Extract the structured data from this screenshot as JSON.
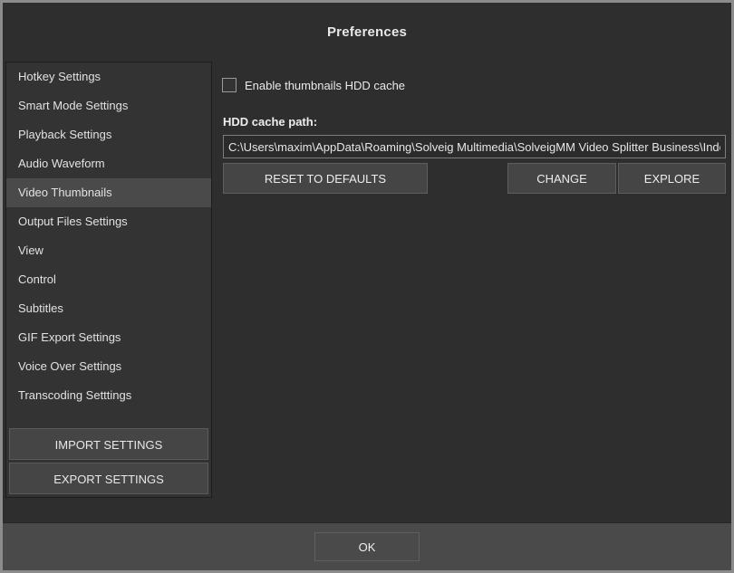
{
  "window": {
    "title": "Preferences"
  },
  "sidebar": {
    "items": [
      {
        "label": "Hotkey Settings",
        "selected": false
      },
      {
        "label": "Smart Mode Settings",
        "selected": false
      },
      {
        "label": "Playback Settings",
        "selected": false
      },
      {
        "label": "Audio Waveform",
        "selected": false
      },
      {
        "label": "Video Thumbnails",
        "selected": true
      },
      {
        "label": "Output Files Settings",
        "selected": false
      },
      {
        "label": "View",
        "selected": false
      },
      {
        "label": "Control",
        "selected": false
      },
      {
        "label": "Subtitles",
        "selected": false
      },
      {
        "label": "GIF Export Settings",
        "selected": false
      },
      {
        "label": "Voice Over Settings",
        "selected": false
      },
      {
        "label": "Transcoding Setttings",
        "selected": false
      }
    ],
    "import_label": "IMPORT SETTINGS",
    "export_label": "EXPORT SETTINGS"
  },
  "main": {
    "enable_cache_label": "Enable thumbnails HDD cache",
    "enable_cache_checked": false,
    "path_label": "HDD cache path:",
    "path_value": "C:\\Users\\maxim\\AppData\\Roaming\\Solveig Multimedia\\SolveigMM Video Splitter Business\\Index\\Thumbnails",
    "reset_label": "RESET TO DEFAULTS",
    "change_label": "CHANGE",
    "explore_label": "EXPLORE"
  },
  "footer": {
    "ok_label": "OK"
  },
  "colors": {
    "window_bg": "#2e2e2e",
    "sidebar_bg": "#333333",
    "selected_bg": "#4a4a4a",
    "button_bg": "#454545",
    "input_bg": "#2b2b2b",
    "text": "#e8e8e8",
    "footer_bg": "#4a4a4a",
    "outer_border": "#8c8c8c"
  }
}
